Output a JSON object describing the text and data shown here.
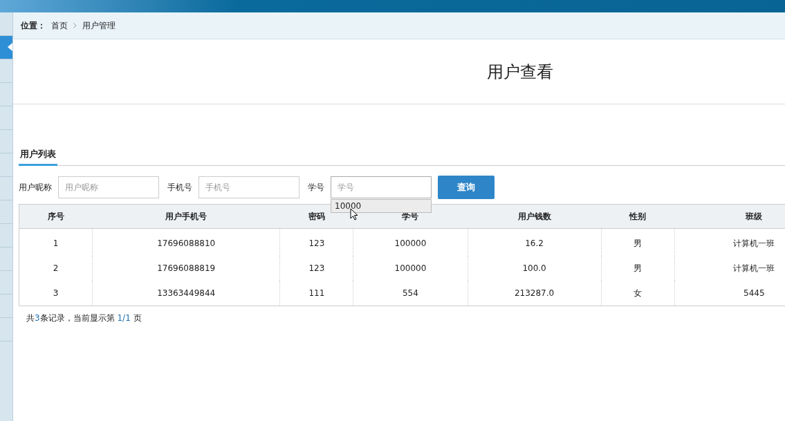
{
  "breadcrumb": {
    "label": "位置：",
    "items": [
      "首页",
      "用户管理"
    ]
  },
  "page_title": "用户查看",
  "tab": {
    "label": "用户列表",
    "selected": true
  },
  "filters": [
    {
      "label": "用户昵称",
      "placeholder": "用户昵称"
    },
    {
      "label": "手机号",
      "placeholder": "手机号"
    },
    {
      "label": "学号",
      "placeholder": "学号",
      "focused": true,
      "suggestions": [
        "10000"
      ]
    }
  ],
  "search_button": "查询",
  "table": {
    "columns": [
      "序号",
      "用户手机号",
      "密码",
      "学号",
      "用户钱数",
      "性别",
      "班级"
    ],
    "rows": [
      [
        "1",
        "17696088810",
        "123",
        "100000",
        "16.2",
        "男",
        "计算机一班"
      ],
      [
        "2",
        "17696088819",
        "123",
        "100000",
        "100.0",
        "男",
        "计算机一班"
      ],
      [
        "3",
        "13363449844",
        "111",
        "554",
        "213287.0",
        "女",
        "5445"
      ]
    ]
  },
  "pagination": {
    "prefix": "共",
    "count": "3",
    "middle": "条记录，当前显示第 ",
    "page": "1/1",
    "suffix": " 页"
  }
}
